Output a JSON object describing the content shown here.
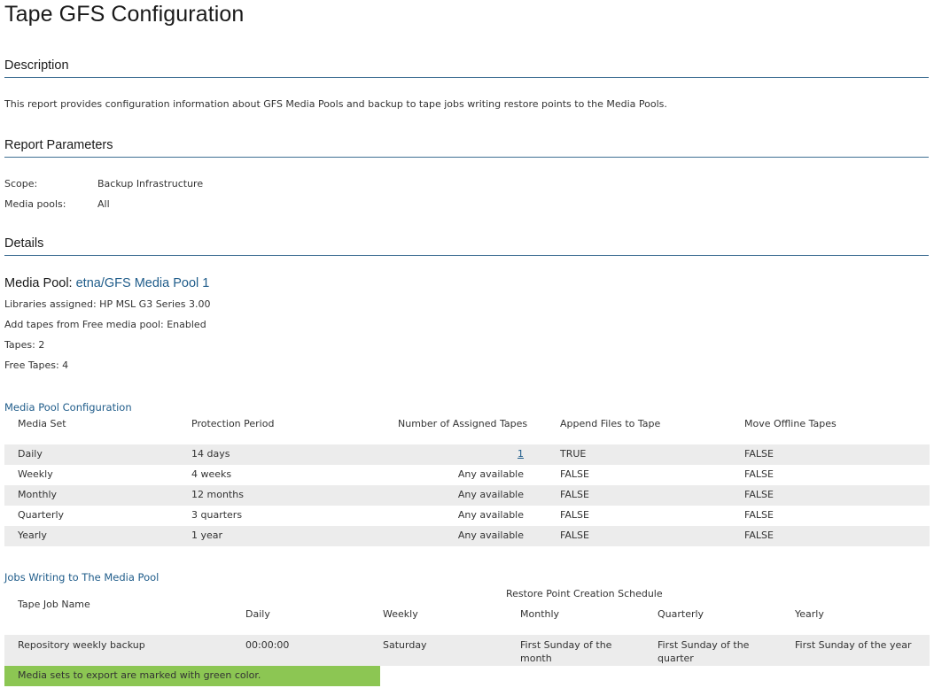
{
  "title": "Tape GFS Configuration",
  "description": {
    "heading": "Description",
    "text": "This report provides configuration information about GFS Media Pools and backup to tape jobs writing restore points to the Media Pools."
  },
  "parameters": {
    "heading": "Report Parameters",
    "items": [
      {
        "label": "Scope:",
        "value": "Backup Infrastructure"
      },
      {
        "label": "Media pools:",
        "value": "All"
      }
    ]
  },
  "details": {
    "heading": "Details",
    "pool_label": "Media Pool: ",
    "pool_name": "etna/GFS Media Pool 1",
    "info": [
      "Libraries assigned: HP MSL G3 Series 3.00",
      "Add tapes from Free media pool: Enabled",
      "Tapes: 2",
      "Free Tapes: 4"
    ]
  },
  "media_pool_config": {
    "heading": "Media Pool Configuration",
    "columns": [
      "Media Set",
      "Protection Period",
      "Number of Assigned Tapes",
      "Append Files to Tape",
      "Move Offline Tapes"
    ],
    "rows": [
      {
        "set": "Daily",
        "period": "14 days",
        "tapes": "1",
        "append": "TRUE",
        "move": "FALSE"
      },
      {
        "set": "Weekly",
        "period": "4 weeks",
        "tapes": "Any available",
        "append": "FALSE",
        "move": "FALSE"
      },
      {
        "set": "Monthly",
        "period": "12 months",
        "tapes": "Any available",
        "append": "FALSE",
        "move": "FALSE"
      },
      {
        "set": "Quarterly",
        "period": "3 quarters",
        "tapes": "Any available",
        "append": "FALSE",
        "move": "FALSE"
      },
      {
        "set": "Yearly",
        "period": "1 year",
        "tapes": "Any available",
        "append": "FALSE",
        "move": "FALSE"
      }
    ]
  },
  "jobs": {
    "heading": "Jobs Writing to The Media Pool",
    "group_header": "Restore Point Creation Schedule",
    "columns": [
      "Tape Job Name",
      "Daily",
      "Weekly",
      "Monthly",
      "Quarterly",
      "Yearly"
    ],
    "rows": [
      {
        "name": "Repository weekly backup",
        "daily": "00:00:00",
        "weekly": "Saturday",
        "monthly": "First Sunday of the month",
        "quarterly": "First Sunday of the quarter",
        "yearly": "First Sunday of the year"
      }
    ]
  },
  "legend": {
    "text": "Media sets to export are marked with green color.",
    "color": "#8cc653"
  }
}
